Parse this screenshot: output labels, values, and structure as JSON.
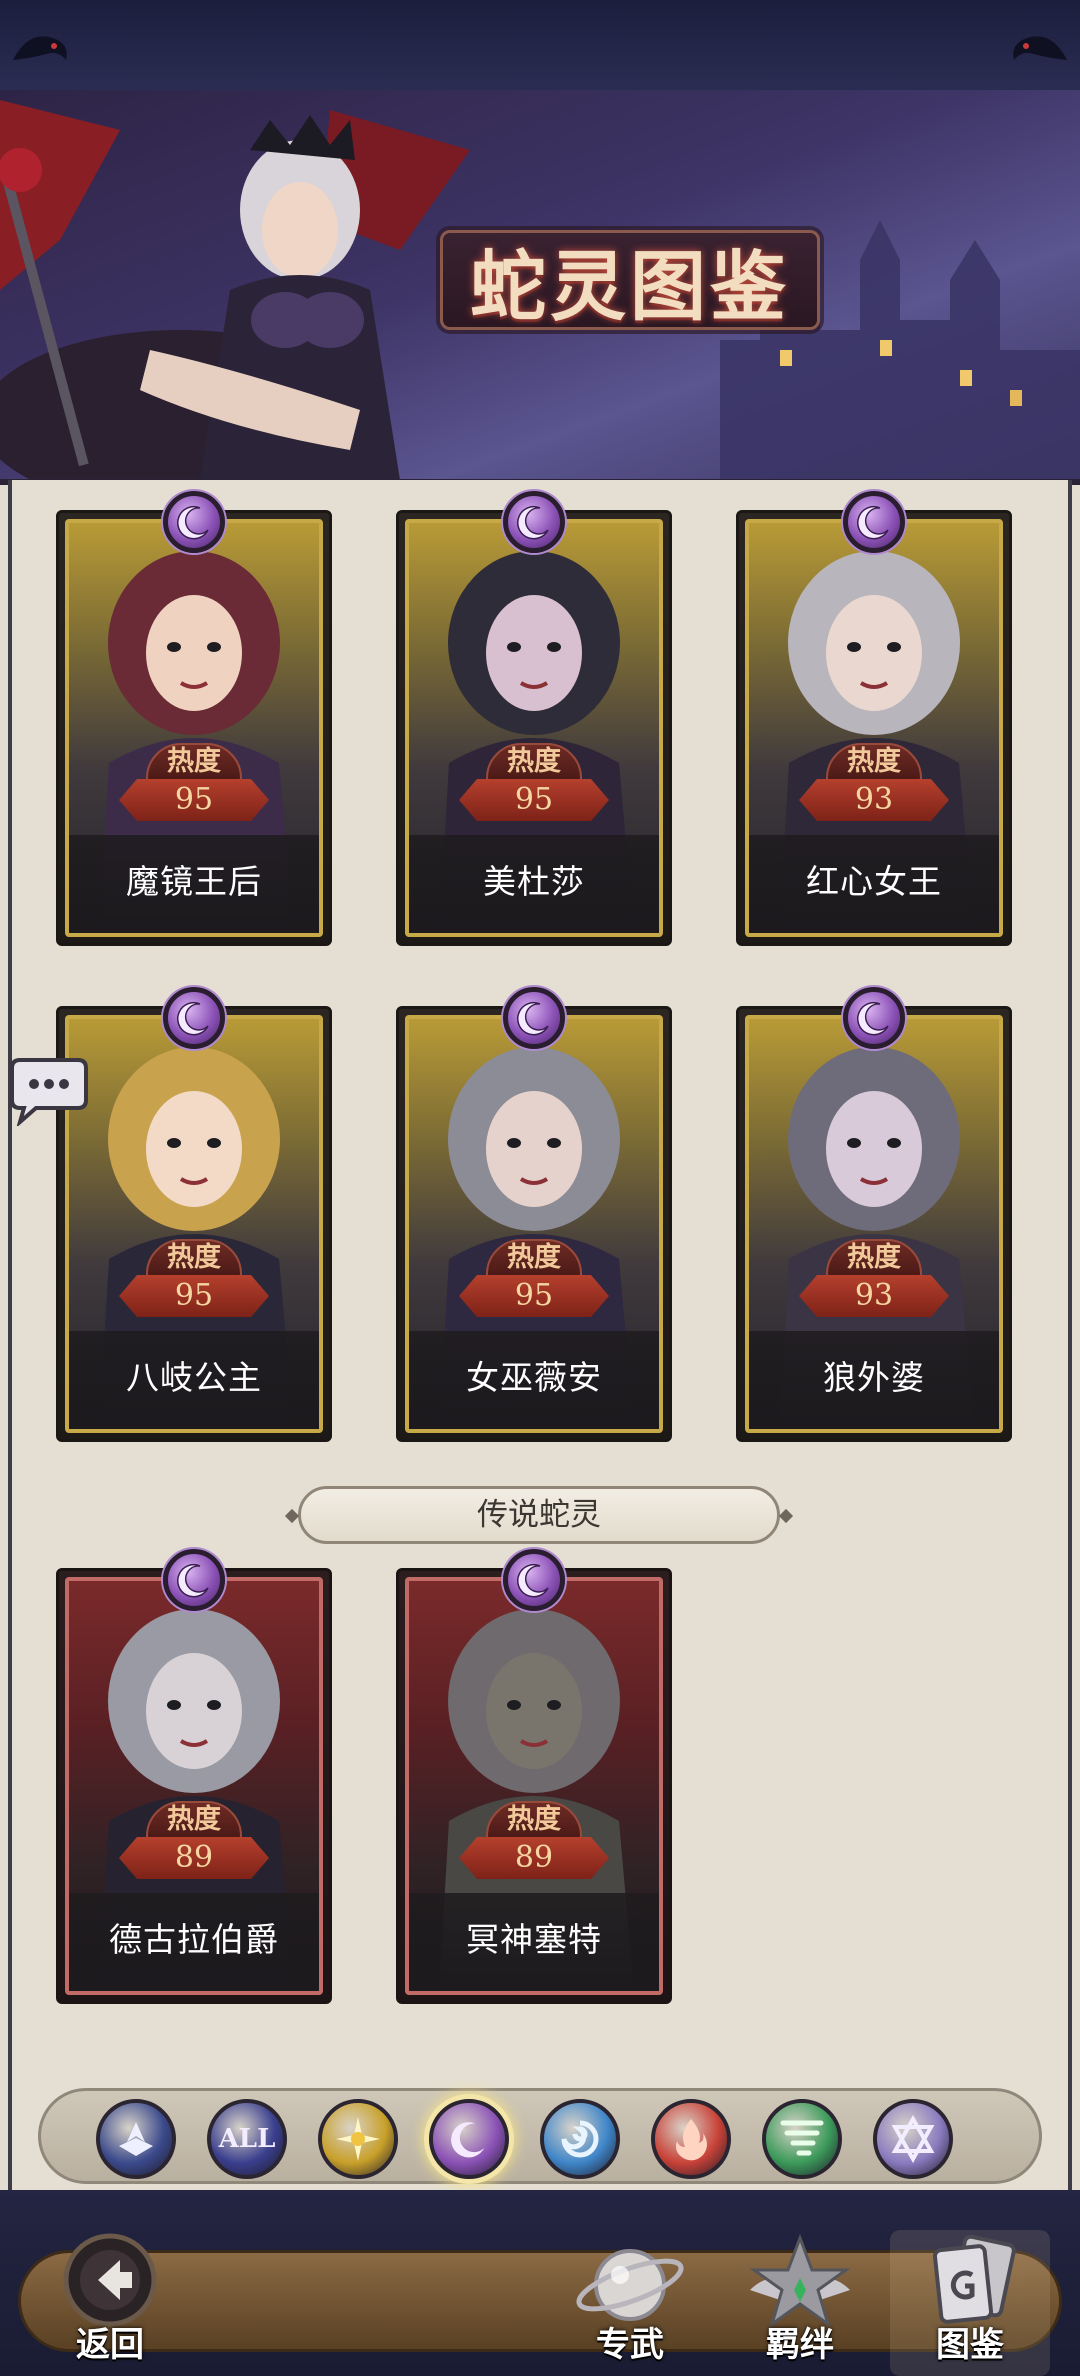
{
  "banner": {
    "title": "蛇灵图鉴"
  },
  "cards": [
    {
      "name": "魔镜王后",
      "heat_label": "热度",
      "heat": "95",
      "rarity": "gold",
      "element": "moon"
    },
    {
      "name": "美杜莎",
      "heat_label": "热度",
      "heat": "95",
      "rarity": "gold",
      "element": "moon"
    },
    {
      "name": "红心女王",
      "heat_label": "热度",
      "heat": "93",
      "rarity": "gold",
      "element": "moon"
    },
    {
      "name": "八岐公主",
      "heat_label": "热度",
      "heat": "95",
      "rarity": "gold",
      "element": "moon"
    },
    {
      "name": "女巫薇安",
      "heat_label": "热度",
      "heat": "95",
      "rarity": "gold",
      "element": "moon"
    },
    {
      "name": "狼外婆",
      "heat_label": "热度",
      "heat": "93",
      "rarity": "gold",
      "element": "moon"
    },
    {
      "name": "德古拉伯爵",
      "heat_label": "热度",
      "heat": "89",
      "rarity": "red",
      "element": "moon"
    },
    {
      "name": "冥神塞特",
      "heat_label": "热度",
      "heat": "89",
      "rarity": "red",
      "element": "moon"
    }
  ],
  "section": {
    "legend_label": "传说蛇灵"
  },
  "filters": [
    {
      "id": "class",
      "label": "",
      "icon": "wing-emblem-icon",
      "color": "#3b4a8c"
    },
    {
      "id": "all",
      "label": "ALL",
      "icon": "all-icon",
      "color": "#3a3f8e"
    },
    {
      "id": "sun",
      "label": "",
      "icon": "sun-icon",
      "color": "#c8a02a"
    },
    {
      "id": "moon",
      "label": "",
      "icon": "moon-icon",
      "color": "#8b52b6",
      "active": true
    },
    {
      "id": "water",
      "label": "",
      "icon": "water-swirl-icon",
      "color": "#3f86c9"
    },
    {
      "id": "fire",
      "label": "",
      "icon": "fire-icon",
      "color": "#c84238"
    },
    {
      "id": "wind",
      "label": "",
      "icon": "tornado-icon",
      "color": "#3c9a5a"
    },
    {
      "id": "star",
      "label": "",
      "icon": "hexagram-icon",
      "color": "#8a7bbf"
    }
  ],
  "nav": {
    "back": "返回",
    "weapon": "专武",
    "bond": "羁绊",
    "codex": "图鉴"
  },
  "colors": {
    "gold_frame": "#c8a948",
    "red_frame": "#c26a66",
    "heat_red": "#b5402d",
    "panel_bg": "#e5dfd3"
  }
}
